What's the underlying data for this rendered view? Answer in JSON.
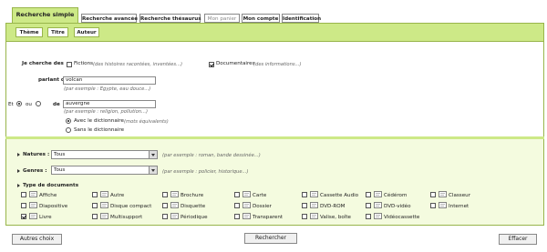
{
  "tabs": [
    {
      "label": "Recherche simple"
    },
    {
      "label": "Recherche avancée"
    },
    {
      "label": "Recherche thésaurus"
    },
    {
      "label": "Mon panier"
    },
    {
      "label": "Mon compte"
    },
    {
      "label": "Identification"
    }
  ],
  "subtabs": [
    {
      "label": "Thème"
    },
    {
      "label": "Titre"
    },
    {
      "label": "Auteur"
    }
  ],
  "search": {
    "je_cherche": "Je cherche des",
    "fictions": {
      "label": "Fictions",
      "hint": "(des histoires racontées, inventées...)",
      "checked": false
    },
    "documentaires": {
      "label": "Documentaires",
      "hint": "(des informations...)",
      "checked": true
    },
    "parlant_de": "parlant de",
    "term1": {
      "value": "volcan",
      "hint": "(par exemple : Egypte, eau douce...)"
    },
    "et": "Et",
    "ou": "ou",
    "de": "de",
    "term2": {
      "value": "auvergne",
      "hint": "(par exemple : religion, pollution...)"
    },
    "avec_dict": {
      "label": "Avec le dictionnaire",
      "hint": "(mots équivalents)"
    },
    "sans_dict": {
      "label": "Sans le dictionnaire"
    }
  },
  "filters": {
    "natures": {
      "label": "Natures :",
      "value": "Tous",
      "hint": "(par exemple : roman, bande dessinée...)"
    },
    "genres": {
      "label": "Genres :",
      "value": "Tous",
      "hint": "(par exemple : policier, historique...)"
    },
    "types_label": "Type de documents"
  },
  "doc_types": [
    {
      "label": "Affiche",
      "icon": "poster-icon",
      "checked": false
    },
    {
      "label": "Autre",
      "icon": "other-icon",
      "checked": false
    },
    {
      "label": "Brochure",
      "icon": "brochure-icon",
      "checked": false
    },
    {
      "label": "Carte",
      "icon": "map-icon",
      "checked": false
    },
    {
      "label": "Cassette Audio",
      "icon": "audio-cassette-icon",
      "checked": false
    },
    {
      "label": "Cédérom",
      "icon": "cdrom-icon",
      "checked": false
    },
    {
      "label": "Classeur",
      "icon": "binder-icon",
      "checked": false
    },
    {
      "label": "Diapositive",
      "icon": "slide-icon",
      "checked": false
    },
    {
      "label": "Disque compact",
      "icon": "compact-disc-icon",
      "checked": false
    },
    {
      "label": "Disquette",
      "icon": "floppy-icon",
      "checked": false
    },
    {
      "label": "Dossier",
      "icon": "folder-icon",
      "checked": false
    },
    {
      "label": "DVD-ROM",
      "icon": "dvdrom-icon",
      "checked": false
    },
    {
      "label": "DVD-vidéo",
      "icon": "dvdvideo-icon",
      "checked": false
    },
    {
      "label": "Internet",
      "icon": "internet-icon",
      "checked": false
    },
    {
      "label": "Livre",
      "icon": "book-icon",
      "checked": true
    },
    {
      "label": "Multisupport",
      "icon": "multisupport-icon",
      "checked": false
    },
    {
      "label": "Périodique",
      "icon": "periodical-icon",
      "checked": false
    },
    {
      "label": "Transparent",
      "icon": "transparency-icon",
      "checked": false
    },
    {
      "label": "Valise, boîte",
      "icon": "box-icon",
      "checked": false
    },
    {
      "label": "Vidéocassette",
      "icon": "videocassette-icon",
      "checked": false
    }
  ],
  "buttons": {
    "autres": "Autres choix",
    "rechercher": "Rechercher",
    "effacer": "Effacer"
  }
}
